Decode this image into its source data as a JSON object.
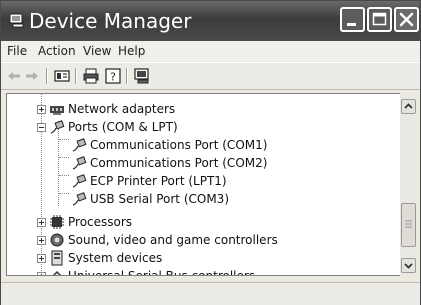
{
  "window": {
    "title": "Device Manager"
  },
  "menu": {
    "items": [
      "File",
      "Action",
      "View",
      "Help"
    ]
  },
  "toolbar": {
    "buttons": [
      "back-icon",
      "forward-icon",
      "properties-icon",
      "print-icon",
      "help-icon",
      "scan-hardware-icon"
    ]
  },
  "tree": {
    "items": [
      {
        "label": "Network adapters",
        "icon": "network-adapter-icon"
      },
      {
        "label": "Ports (COM & LPT)",
        "icon": "port-icon"
      },
      {
        "label": "Communications Port (COM1)",
        "icon": "port-icon"
      },
      {
        "label": "Communications Port (COM2)",
        "icon": "port-icon"
      },
      {
        "label": "ECP Printer Port (LPT1)",
        "icon": "port-icon"
      },
      {
        "label": "USB Serial Port (COM3)",
        "icon": "port-icon"
      },
      {
        "label": "Processors",
        "icon": "processor-icon"
      },
      {
        "label": "Sound, video and game controllers",
        "icon": "sound-icon"
      },
      {
        "label": "System devices",
        "icon": "system-device-icon"
      },
      {
        "label": "Universal Serial Bus controllers",
        "icon": "usb-icon"
      }
    ]
  }
}
